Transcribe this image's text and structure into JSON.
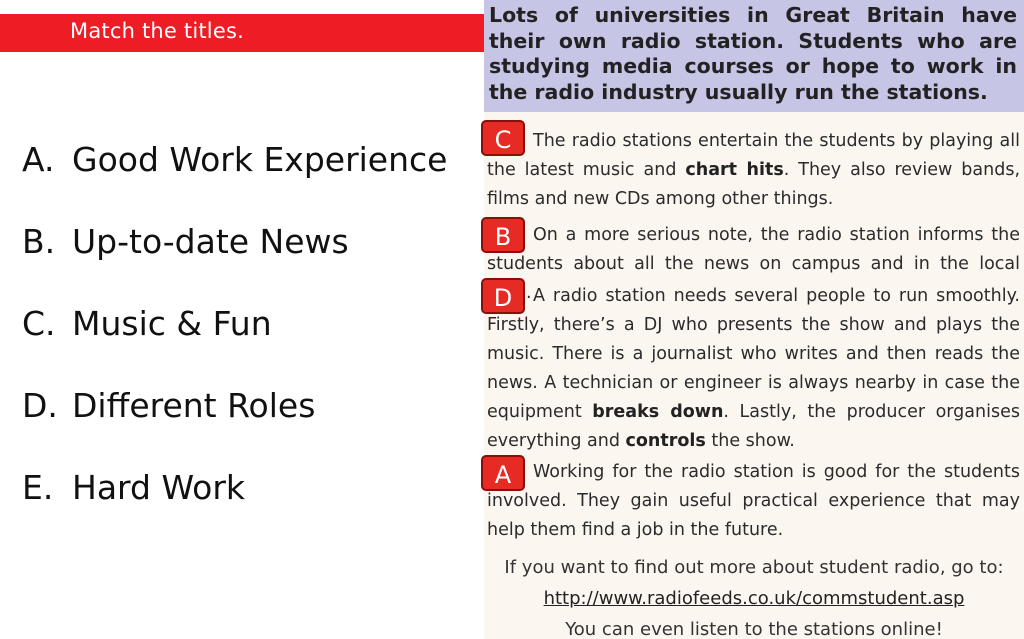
{
  "header": {
    "title": "Match the titles."
  },
  "options": [
    {
      "letter": "A.",
      "text": "Good Work Experience"
    },
    {
      "letter": "B.",
      "text": "Up-to-date News"
    },
    {
      "letter": "C.",
      "text": "Music & Fun"
    },
    {
      "letter": "D.",
      "text": "Different Roles"
    },
    {
      "letter": "E.",
      "text": "Hard Work"
    }
  ],
  "article": {
    "intro": "Lots of universities in Great Britain have their own radio station. Students who are studying media courses or hope to work in the radio industry usually run the stations.",
    "paragraphs": [
      {
        "answer": "C",
        "parts": [
          "The radio stations entertain the students by playing all the latest music and ",
          "chart hits",
          ". They also review bands, films and new CDs among other things."
        ]
      },
      {
        "answer": "B",
        "parts": [
          "On a more serious note, the radio station informs the students about all the news on campus and in the local area."
        ]
      },
      {
        "answer": "D",
        "parts": [
          "A radio station needs several people to run smoothly. Firstly, there’s a DJ who presents the show and plays the music. There is a journalist who writes and then reads the news. A technician or engineer is always nearby in case the equipment ",
          "breaks down",
          ". Lastly, the producer organises everything and ",
          "controls",
          " the show."
        ]
      },
      {
        "answer": "A",
        "parts": [
          "Working for the radio station is good for the students involved. They gain useful practical experience that may help them find a job in the future."
        ]
      }
    ],
    "footer": {
      "line1": "If you want to find out more about student radio, go to:",
      "link": "http://www.radiofeeds.co.uk/commstudent.asp",
      "line3": "You can even listen to the stations online!"
    }
  },
  "colors": {
    "header_red": "#ee1c25",
    "badge_red": "#e52b24",
    "intro_bg": "#c6c5e6"
  }
}
